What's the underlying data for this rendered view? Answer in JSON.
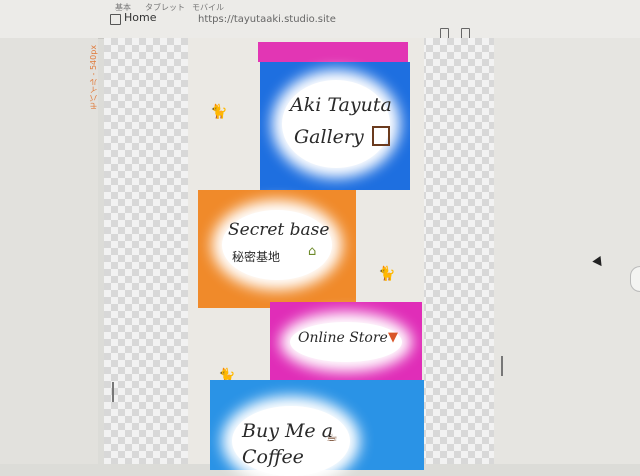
{
  "toolbar": {
    "tabs": [
      "基本",
      "タブレット",
      "モバイル"
    ],
    "home_label": "Home",
    "url": "https://tayutaaki.studio.site"
  },
  "viewport_label": "モバイル - 540px",
  "cards": {
    "gallery": {
      "title_line1": "Aki Tayuta",
      "title_line2": "Gallery",
      "icon": "picture-frame-icon",
      "color": "#1e6fe0",
      "top_strip": "#e236b4"
    },
    "secret": {
      "title_line1": "Secret base",
      "title_line2": "秘密基地",
      "icon": "house-icon",
      "color": "#f08a2a"
    },
    "store": {
      "title": "Online Store",
      "icon": "tshirt-icon",
      "color": "#e02db8"
    },
    "coffee": {
      "title_line1": "Buy Me a",
      "title_line2": "Coffee",
      "icon": "coffee-cup-icon",
      "color": "#2a93e6"
    }
  }
}
